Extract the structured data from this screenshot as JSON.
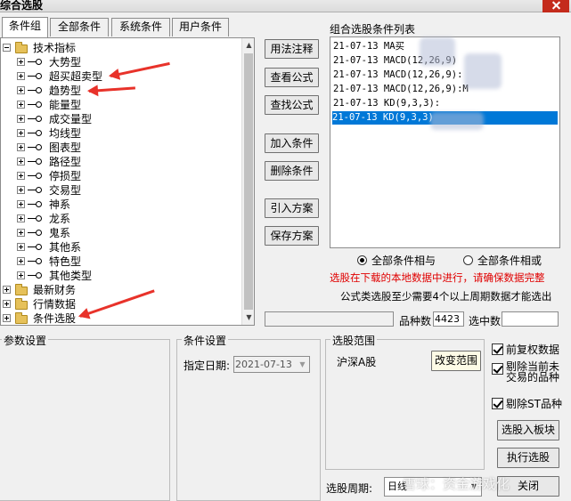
{
  "window": {
    "title": "综合选股"
  },
  "tabs": [
    "条件组",
    "全部条件",
    "系统条件",
    "用户条件"
  ],
  "tree": {
    "root": "技术指标",
    "children": [
      "大势型",
      "超买超卖型",
      "趋势型",
      "能量型",
      "成交量型",
      "均线型",
      "图表型",
      "路径型",
      "停损型",
      "交易型",
      "神系",
      "龙系",
      "鬼系",
      "其他系",
      "特色型",
      "其他类型"
    ],
    "folders": [
      "最新财务",
      "行情数据",
      "条件选股"
    ]
  },
  "buttons": {
    "usage_note": "用法注释",
    "view_formula": "查看公式",
    "find_formula": "查找公式",
    "add_condition": "加入条件",
    "delete_condition": "删除条件",
    "import_scheme": "引入方案",
    "save_scheme": "保存方案",
    "change_range": "改变范围",
    "select_to_block": "选股入板块",
    "execute": "执行选股",
    "close": "关闭"
  },
  "condition_list": {
    "title": "组合选股条件列表",
    "items": [
      "21-07-13 MA买",
      "21-07-13 MACD(12,26,9)",
      "21-07-13 MACD(12,26,9):",
      "21-07-13 MACD(12,26,9):M",
      "21-07-13 KD(9,3,3):",
      "21-07-13 KD(9,3,3)"
    ],
    "selected_index": 5
  },
  "logic": {
    "and_label": "全部条件相与",
    "or_label": "全部条件相或",
    "selected": "and"
  },
  "warning": "选股在下载的本地数据中进行，请确保数据完整",
  "hint": "公式类选股至少需要4个以上周期数据才能选出",
  "stats": {
    "count_label": "品种数",
    "count_value": "4423",
    "selected_label": "选中数",
    "selected_value": ""
  },
  "param_settings": {
    "title": "参数设置"
  },
  "condition_settings": {
    "title": "条件设置",
    "date_label": "指定日期:",
    "date_value": "2021-07-13"
  },
  "range": {
    "title": "选股范围",
    "value": "沪深A股"
  },
  "checkboxes": [
    {
      "label": "前复权数据",
      "checked": true
    },
    {
      "label_line1": "剔除当前未",
      "label_line2": "交易的品种",
      "checked": true
    },
    {
      "label": "剔除ST品种",
      "checked": true
    }
  ],
  "period": {
    "label": "选股周期:",
    "value": "日线"
  },
  "watermark": "雪球：资金游戏化",
  "colors": {
    "selection": "#0078d7",
    "warning": "#e00000",
    "arrow": "#e8322a"
  }
}
